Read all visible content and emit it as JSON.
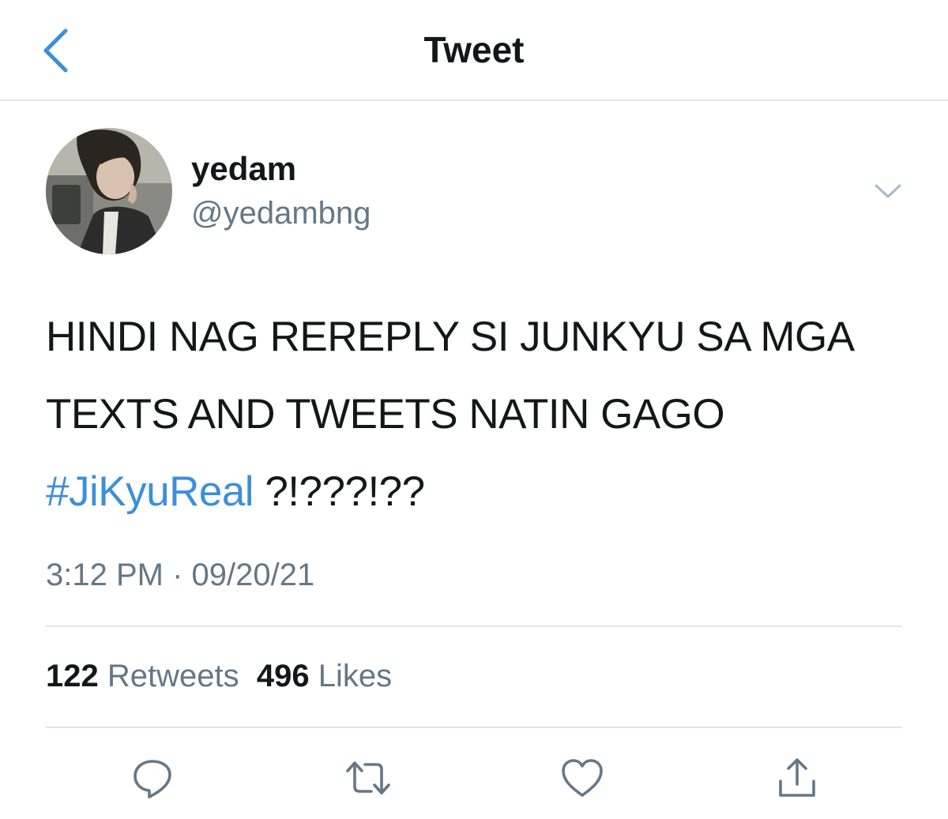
{
  "header": {
    "title": "Tweet",
    "back_icon": "chevron-left-icon"
  },
  "author": {
    "display_name": "yedam",
    "handle": "@yedambng",
    "menu_icon": "chevron-down-icon"
  },
  "tweet": {
    "text_before": "HINDI NAG REREPLY SI JUNKYU SA MGA TEXTS AND TWEETS NATIN GAGO ",
    "hashtag": "#JiKyuReal",
    "text_after": " ?!???!??",
    "timestamp": "3:12 PM · 09/20/21"
  },
  "stats": {
    "retweets_count": "122",
    "retweets_label": "Retweets",
    "likes_count": "496",
    "likes_label": "Likes"
  },
  "actions": {
    "reply_icon": "reply-icon",
    "retweet_icon": "retweet-icon",
    "like_icon": "heart-icon",
    "share_icon": "share-icon"
  },
  "colors": {
    "accent": "#3c8fd9",
    "icon": "#657786",
    "text": "#14171a",
    "secondary": "#657786",
    "divider": "#e1e4e7"
  }
}
